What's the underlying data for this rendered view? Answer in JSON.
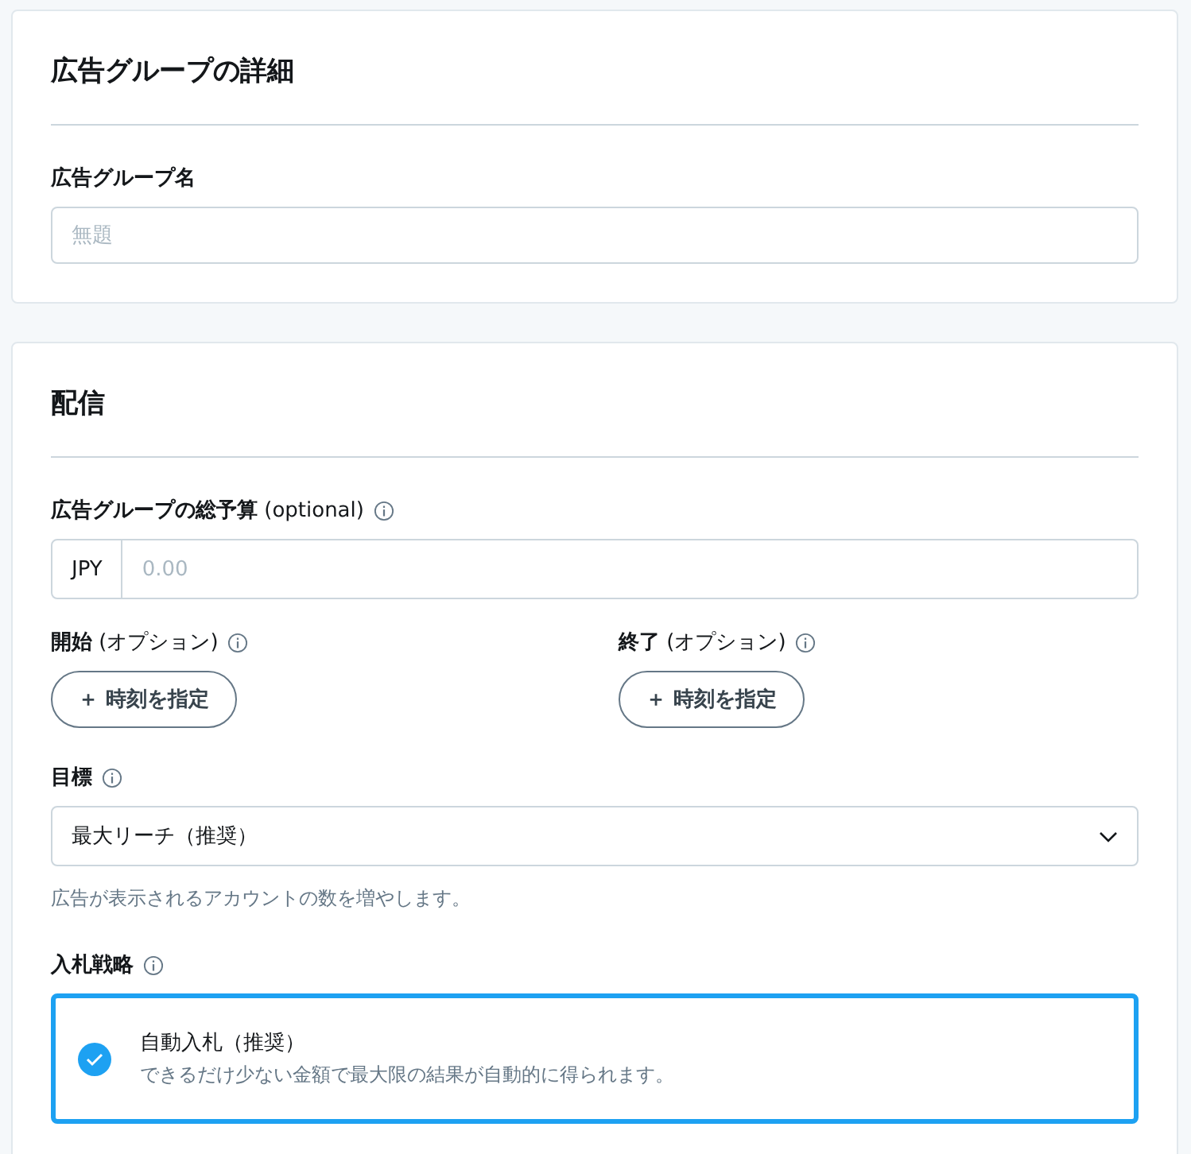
{
  "details": {
    "title": "広告グループの詳細",
    "name_label": "広告グループ名",
    "name_placeholder": "無題"
  },
  "delivery": {
    "title": "配信",
    "budget": {
      "label": "**広告グループの総予算** (optional)",
      "currency": "JPY",
      "placeholder": "0.00"
    },
    "schedule": [
      {
        "label": "**開始** (オプション)",
        "button": "＋ 時刻を指定"
      },
      {
        "label": "**終了** (オプション)",
        "button": "＋ 時刻を指定"
      }
    ],
    "goal": {
      "label": "目標",
      "value": "最大リーチ（推奨）",
      "help": "広告が表示されるアカウントの数を増やします。"
    },
    "bid_strategy": {
      "label": "入札戦略",
      "options": [
        {
          "title": "自動入札（推奨）",
          "description": "できるだけ少ない金額で最大限の結果が自動的に得られます。",
          "selected": true
        }
      ]
    }
  }
}
